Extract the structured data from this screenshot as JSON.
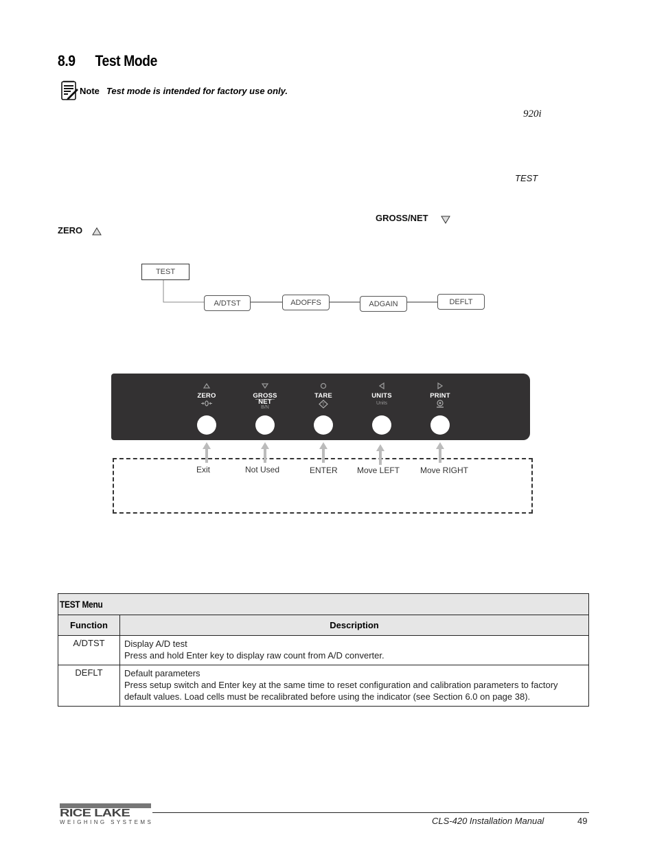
{
  "section": {
    "number": "8.9",
    "title": "Test Mode"
  },
  "note": {
    "icon": "notepad-pencil-icon",
    "label": "Note",
    "text": "Test mode is intended for factory use only."
  },
  "fragments": {
    "model": "920i",
    "test": "TEST",
    "gross_net": "GROSS/NET",
    "zero": "ZERO"
  },
  "menu_tree": {
    "root": "TEST",
    "items": [
      "A/DTST",
      "ADOFFS",
      "ADGAIN",
      "DEFLT"
    ]
  },
  "keypad": {
    "keys": [
      {
        "label": "ZERO",
        "symbol": "triangle-up-icon",
        "sub_icon": "zero-arrows-icon",
        "function": "Exit"
      },
      {
        "label": "GROSS",
        "label2": "NET",
        "sub": "B/N",
        "symbol": "triangle-down-icon",
        "function": "Not Used"
      },
      {
        "label": "TARE",
        "symbol": "circle-icon",
        "sub_icon": "tare-diamond-icon",
        "function": "ENTER"
      },
      {
        "label": "UNITS",
        "sub": "Units",
        "symbol": "triangle-left-icon",
        "function": "Move LEFT"
      },
      {
        "label": "PRINT",
        "symbol": "triangle-right-icon",
        "sub_icon": "printer-icon",
        "function": "Move RIGHT"
      }
    ],
    "colors": {
      "panel": "#333132",
      "arrow": "#bbbbbb"
    }
  },
  "table": {
    "title": "TEST Menu",
    "headers": [
      "Function",
      "Description"
    ],
    "rows": [
      {
        "function": "A/DTST",
        "lines": [
          "Display A/D test",
          "Press and hold Enter key to display raw count from A/D converter."
        ]
      },
      {
        "function": "DEFLT",
        "lines": [
          "Default parameters",
          "Press setup switch and Enter key at the same time to reset configuration and calibration parameters to factory default values. Load cells must be recalibrated before using the indicator (see Section 6.0 on page 38)."
        ]
      }
    ]
  },
  "footer": {
    "brand": "RICE LAKE",
    "brand_sub": "WEIGHING SYSTEMS",
    "manual": "CLS-420 Installation Manual",
    "page": "49"
  }
}
